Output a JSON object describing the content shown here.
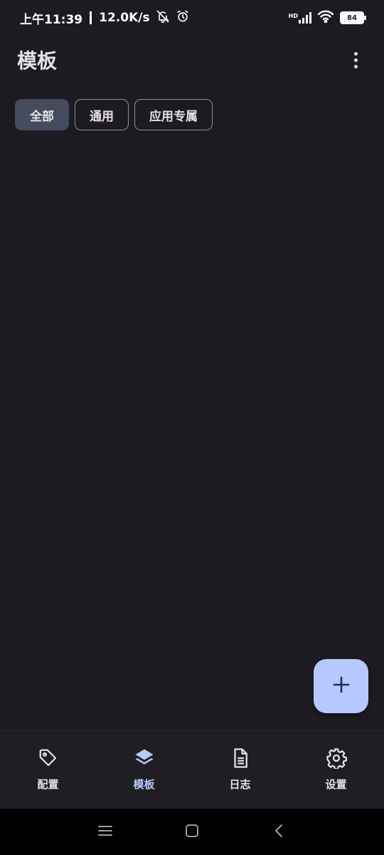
{
  "status_bar": {
    "time": "上午11:39",
    "net_speed": "12.0K/s",
    "hd": "HD",
    "battery": "84"
  },
  "app_bar": {
    "title": "模板",
    "more_icon": "more-vert-icon"
  },
  "chips": [
    {
      "label": "全部",
      "selected": true
    },
    {
      "label": "通用",
      "selected": false
    },
    {
      "label": "应用专属",
      "selected": false
    }
  ],
  "fab": {
    "icon": "add-icon"
  },
  "bottom_nav": {
    "items": [
      {
        "label": "配置",
        "icon": "tag-icon",
        "active": false
      },
      {
        "label": "模板",
        "icon": "layers-icon",
        "active": true
      },
      {
        "label": "日志",
        "icon": "document-icon",
        "active": false
      },
      {
        "label": "设置",
        "icon": "gear-icon",
        "active": false
      }
    ]
  },
  "colors": {
    "background": "#1c1b1f",
    "accent": "#b6c8ff",
    "chip_selected": "#454a5c"
  }
}
